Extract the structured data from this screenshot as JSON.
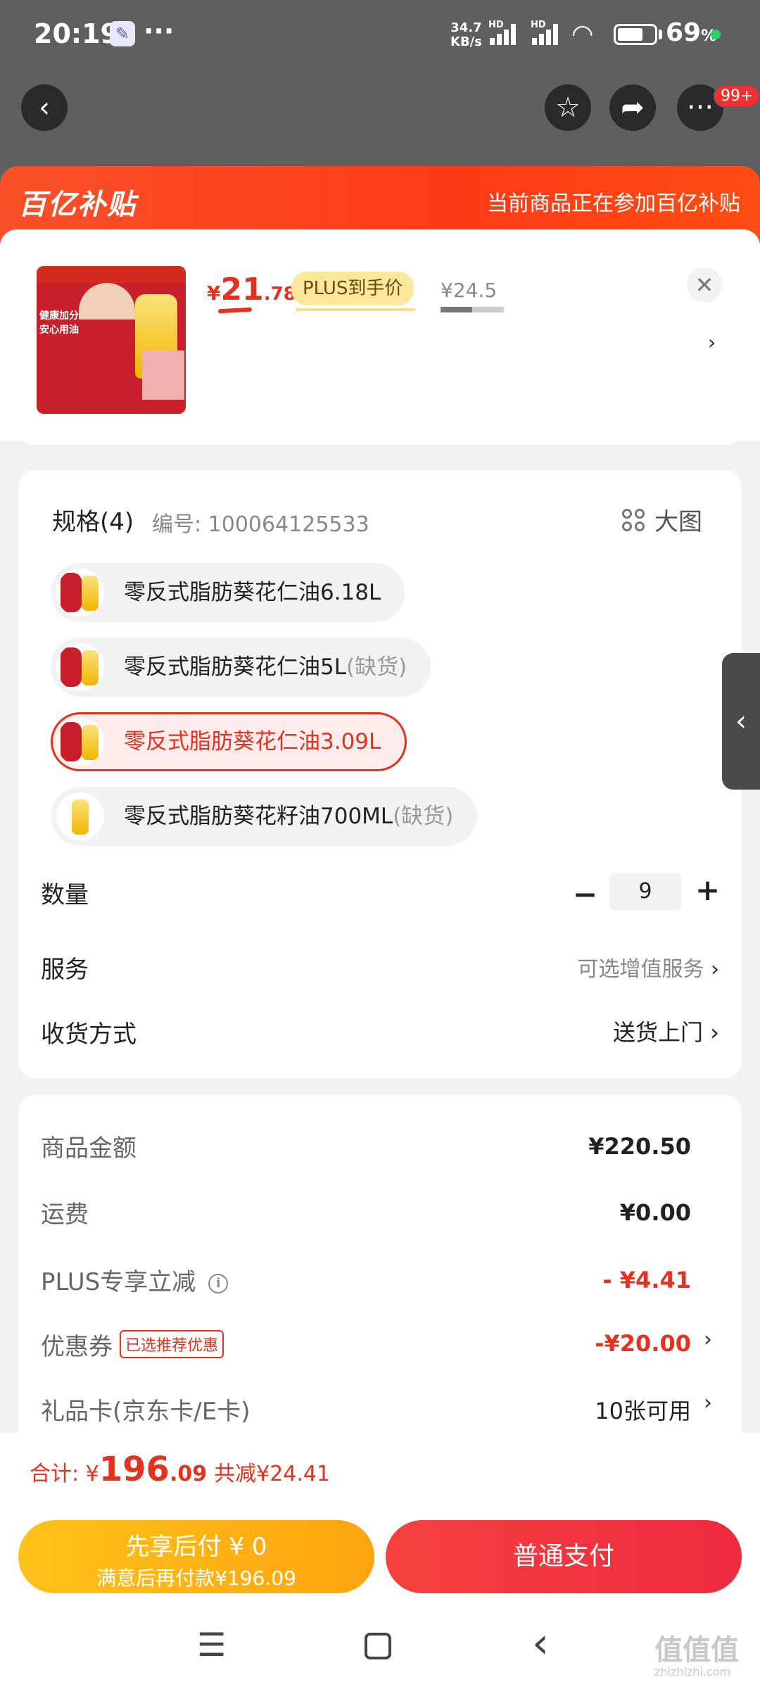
{
  "status_bar": {
    "time": "20:19",
    "net_speed": "34.7",
    "net_unit": "KB/s",
    "hd1": "HD",
    "hd2": "HD",
    "battery_percent": "69",
    "battery_level": 0.69,
    "icons": [
      "wrench-icon",
      "more-dots-icon",
      "signal-icon",
      "wifi-icon",
      "battery-icon"
    ]
  },
  "top_nav": {
    "back_icon": "chevron-left-icon",
    "favorite_icon": "star-icon",
    "share_icon": "share-icon",
    "more_icon": "more-dots-icon",
    "badge": "99+"
  },
  "banner": {
    "logo": "百亿补贴",
    "note": "当前商品正在参加百亿补贴"
  },
  "product": {
    "price_yen": "¥",
    "price_int": "21",
    "price_dec": ".78",
    "plus_tag": "PLUS到手价",
    "original_price": "¥24.5",
    "close_icon": "close-icon",
    "thumb_text": "健康加分 安心用油"
  },
  "spec": {
    "title": "规格(4)",
    "code": "编号: 100064125533",
    "big_image": "大图",
    "options": [
      {
        "label": "零反式脂肪葵花仁油6.18L",
        "suffix": "",
        "selected": false
      },
      {
        "label": "零反式脂肪葵花仁油5L",
        "suffix": "(缺货)",
        "selected": false
      },
      {
        "label": "零反式脂肪葵花仁油3.09L",
        "suffix": "",
        "selected": true
      },
      {
        "label": "零反式脂肪葵花籽油700ML",
        "suffix": "(缺货)",
        "selected": false
      }
    ]
  },
  "quantity": {
    "label": "数量",
    "minus": "−",
    "value": "9",
    "plus": "+"
  },
  "service": {
    "label": "服务",
    "value": "可选增值服务"
  },
  "delivery": {
    "label": "收货方式",
    "value": "送货上门"
  },
  "price_detail": {
    "goods_label": "商品金额",
    "goods_value": "¥220.50",
    "shipping_label": "运费",
    "shipping_value": "¥0.00",
    "plus_label": "PLUS专享立减",
    "plus_value": "- ¥4.41",
    "coupon_label": "优惠券",
    "coupon_tag": "已选推荐优惠",
    "coupon_value": "-¥20.00",
    "giftcard_label": "礼品卡(京东卡/E卡)",
    "giftcard_value": "10张可用"
  },
  "footer": {
    "total_label": "合计: ",
    "total_yen": "¥",
    "total_int": "196",
    "total_dec": ".09",
    "total_saved": "共减¥24.41",
    "pay_later_line1": "先享后付 ¥ 0",
    "pay_later_line2": "满意后再付款¥196.09",
    "pay_now": "普通支付"
  },
  "system_nav": {
    "menu": "☰",
    "back": "‹"
  },
  "watermark": {
    "main": "值值值",
    "sub": "zhizhizhi.com"
  },
  "colors": {
    "accent": "#e4321e",
    "banner": "#ff3a16",
    "pay_later": "#ffb012",
    "pay_now": "#f0303f"
  }
}
